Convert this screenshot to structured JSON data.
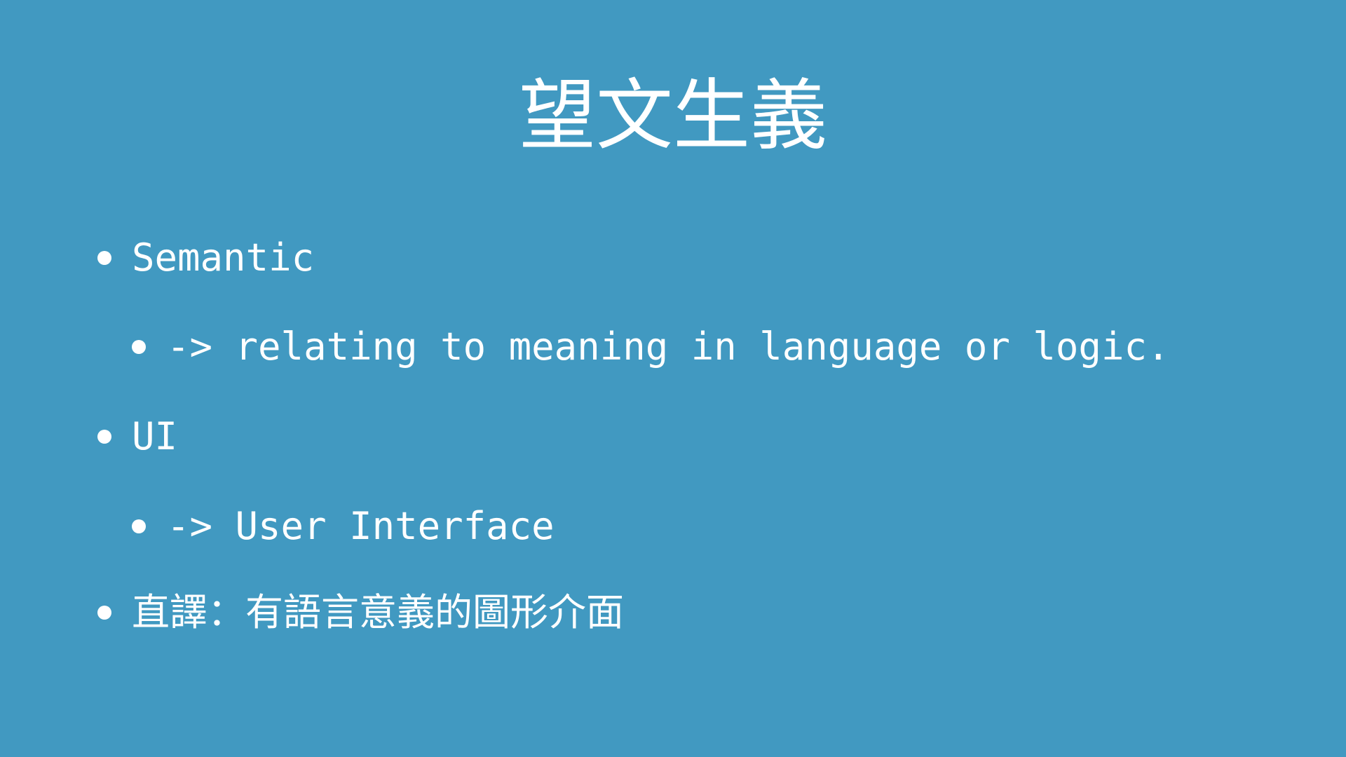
{
  "slide": {
    "title": "望文生義",
    "items": [
      {
        "level": 1,
        "text": "Semantic"
      },
      {
        "level": 2,
        "text": "-> relating to meaning in language or logic."
      },
      {
        "level": 1,
        "text": "UI"
      },
      {
        "level": 2,
        "text": "-> User Interface"
      },
      {
        "level": 1,
        "text": "直譯：有語言意義的圖形介面"
      }
    ]
  },
  "colors": {
    "background": "#4199c1",
    "text": "#ffffff"
  }
}
